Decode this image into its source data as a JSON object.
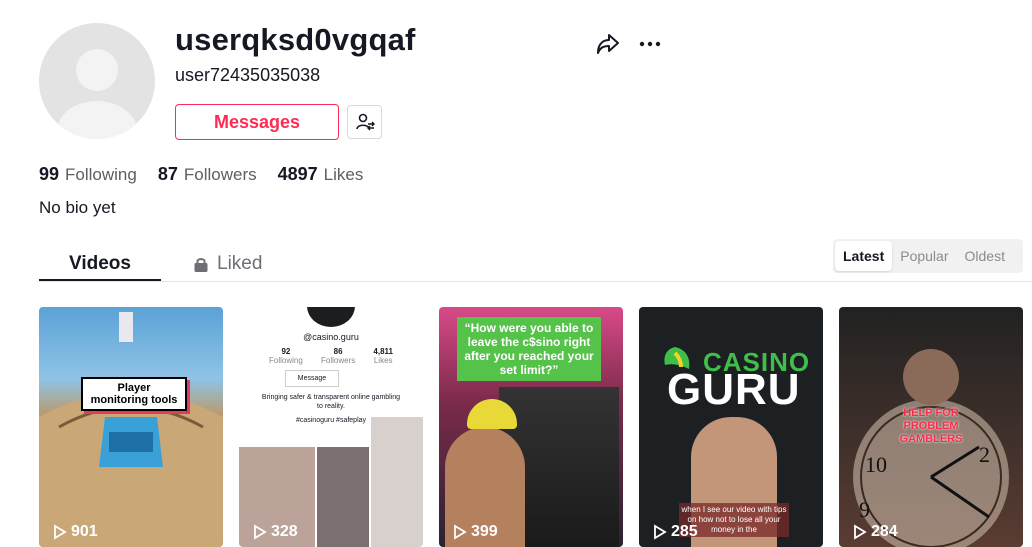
{
  "profile": {
    "username": "userqksd0vgqaf",
    "handle": "user72435035038",
    "bio": "No bio yet"
  },
  "actions": {
    "messages_label": "Messages"
  },
  "stats": {
    "following_count": "99",
    "following_label": "Following",
    "followers_count": "87",
    "followers_label": "Followers",
    "likes_count": "4897",
    "likes_label": "Likes"
  },
  "tabs": {
    "videos": "Videos",
    "liked": "Liked"
  },
  "sort": {
    "latest": "Latest",
    "popular": "Popular",
    "oldest": "Oldest",
    "active": "Latest"
  },
  "videos": [
    {
      "views": "901",
      "overlay": "Player monitoring tools"
    },
    {
      "views": "328",
      "channel": "@casino.guru",
      "following_count": "92",
      "following_label": "Following",
      "followers_count": "86",
      "followers_label": "Followers",
      "likes_count": "4,811",
      "likes_label": "Likes",
      "message_label": "Message",
      "bio": "Bringing safer & transparent online gambling to reality.",
      "hashtags": "#casinoguru #safeplay"
    },
    {
      "views": "399",
      "overlay": "“How were you able to leave the c$sino right after you reached your set limit?”"
    },
    {
      "views": "285",
      "logo_top": "CASINO",
      "logo_bottom": "GURU",
      "caption": "when I see our video with tips on how not to lose all your money in the"
    },
    {
      "views": "284",
      "overlay": "HELP FOR PROBLEM GAMBLERS"
    }
  ],
  "colors": {
    "accent": "#fe2c55",
    "text": "#161823",
    "muted": "#5d5e66"
  }
}
